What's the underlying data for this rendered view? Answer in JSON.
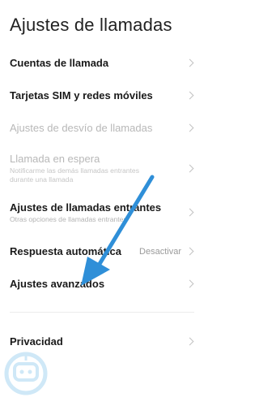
{
  "header": {
    "title": "Ajustes de llamadas"
  },
  "settings": {
    "items": [
      {
        "label": "Cuentas de llamada"
      },
      {
        "label": "Tarjetas SIM y redes móviles"
      },
      {
        "label": "Ajustes de desvío de llamadas"
      },
      {
        "label": "Llamada en espera",
        "sub1": "Notificarme las demás llamadas entrantes",
        "sub2": "durante una llamada"
      },
      {
        "label": "Ajustes de llamadas entrantes",
        "sub1": "Otras opciones de llamadas entrantes"
      },
      {
        "label": "Respuesta automática",
        "value": "Desactivar"
      },
      {
        "label": "Ajustes avanzados"
      }
    ],
    "privacy": {
      "label": "Privacidad"
    }
  },
  "colors": {
    "arrow": "#2f8fd8",
    "watermark": "#cfe8f7"
  },
  "icons": {
    "chevron": "chevron-right-icon",
    "arrow": "arrow-annotation-icon"
  }
}
